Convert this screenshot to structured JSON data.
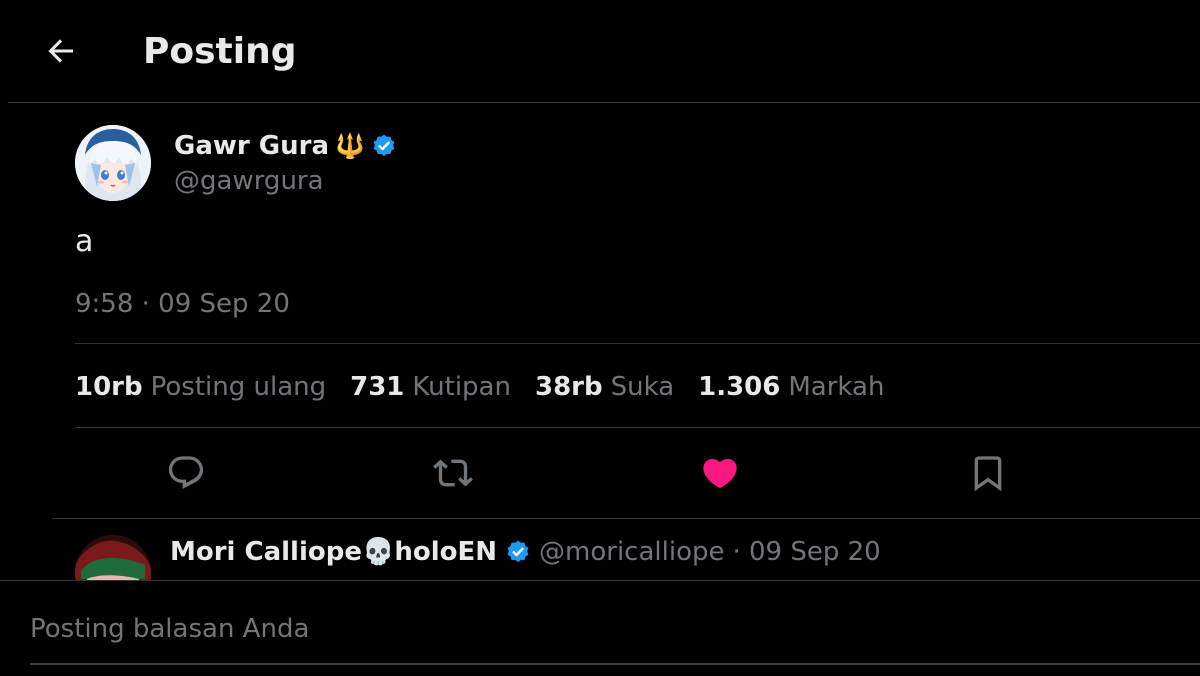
{
  "header": {
    "title": "Posting",
    "back_icon": "arrow-left-icon"
  },
  "post": {
    "author_name": "Gawr Gura",
    "author_emoji": "🔱",
    "author_handle": "@gawrgura",
    "verified_icon": "verified-badge-icon",
    "text": "a",
    "time": "9:58 · 09 Sep 20",
    "stats": [
      {
        "value": "10rb",
        "label": "Posting ulang"
      },
      {
        "value": "731",
        "label": "Kutipan"
      },
      {
        "value": "38rb",
        "label": "Suka"
      },
      {
        "value": "1.306",
        "label": "Markah"
      }
    ],
    "actions": [
      {
        "name": "reply",
        "icon": "comment-icon"
      },
      {
        "name": "repost",
        "icon": "repost-icon"
      },
      {
        "name": "like",
        "icon": "heart-icon",
        "liked": true
      },
      {
        "name": "bookmark",
        "icon": "bookmark-icon"
      }
    ]
  },
  "reply": {
    "author_name": "Mori Calliope💀holoEN",
    "author_handle": "@moricalliope",
    "date": "· 09 Sep 20"
  },
  "composer": {
    "placeholder": "Posting balasan Anda"
  },
  "colors": {
    "background": "#000000",
    "text_primary": "#e7e9ea",
    "text_secondary": "#71767b",
    "divider": "#2f3336",
    "verified": "#1d9bf0",
    "like": "#f91880"
  }
}
